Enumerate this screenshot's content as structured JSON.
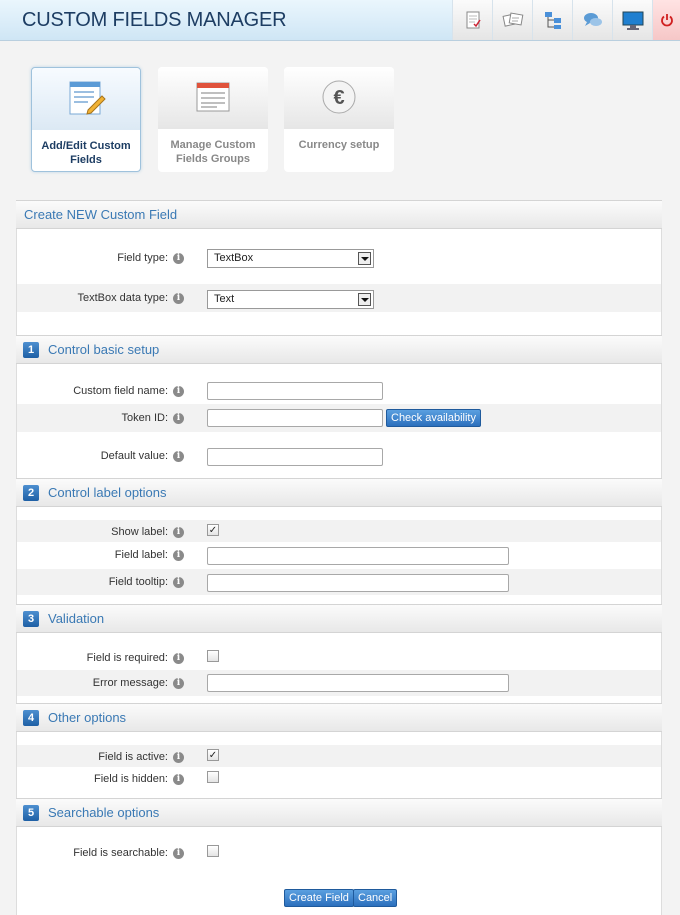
{
  "header": {
    "title": "CUSTOM FIELDS MANAGER",
    "icons": [
      "checklist-icon",
      "cards-icon",
      "sitemap-icon",
      "chat-icon",
      "monitor-icon",
      "power-icon"
    ]
  },
  "tiles": [
    {
      "label": "Add/Edit Custom Fields",
      "icon": "form-edit-icon",
      "active": true
    },
    {
      "label": "Manage Custom Fields Groups",
      "icon": "window-icon",
      "active": false
    },
    {
      "label": "Currency setup",
      "icon": "euro-icon",
      "active": false
    }
  ],
  "create_section": {
    "title": "Create NEW Custom Field",
    "field_type_label": "Field type:",
    "field_type_value": "TextBox",
    "data_type_label": "TextBox data type:",
    "data_type_value": "Text"
  },
  "basic_setup": {
    "number": "1",
    "title": "Control basic setup",
    "name_label": "Custom field name:",
    "name_value": "",
    "token_label": "Token ID:",
    "token_value": "",
    "check_button": "Check availability",
    "default_label": "Default value:",
    "default_value": ""
  },
  "label_options": {
    "number": "2",
    "title": "Control label options",
    "show_label": "Show label:",
    "show_checked": true,
    "field_label": "Field label:",
    "field_label_value": "",
    "tooltip_label": "Field tooltip:",
    "tooltip_value": ""
  },
  "validation": {
    "number": "3",
    "title": "Validation",
    "required_label": "Field is required:",
    "required_checked": false,
    "error_label": "Error message:",
    "error_value": ""
  },
  "other_options": {
    "number": "4",
    "title": "Other options",
    "active_label": "Field is active:",
    "active_checked": true,
    "hidden_label": "Field is hidden:",
    "hidden_checked": false
  },
  "searchable": {
    "number": "5",
    "title": "Searchable options",
    "searchable_label": "Field is searchable:",
    "searchable_checked": false
  },
  "actions": {
    "create": "Create Field",
    "cancel": "Cancel"
  },
  "colors": {
    "section_title": "#3a79b4",
    "header_title": "#1d3d63",
    "button": "#2c6fbd"
  }
}
